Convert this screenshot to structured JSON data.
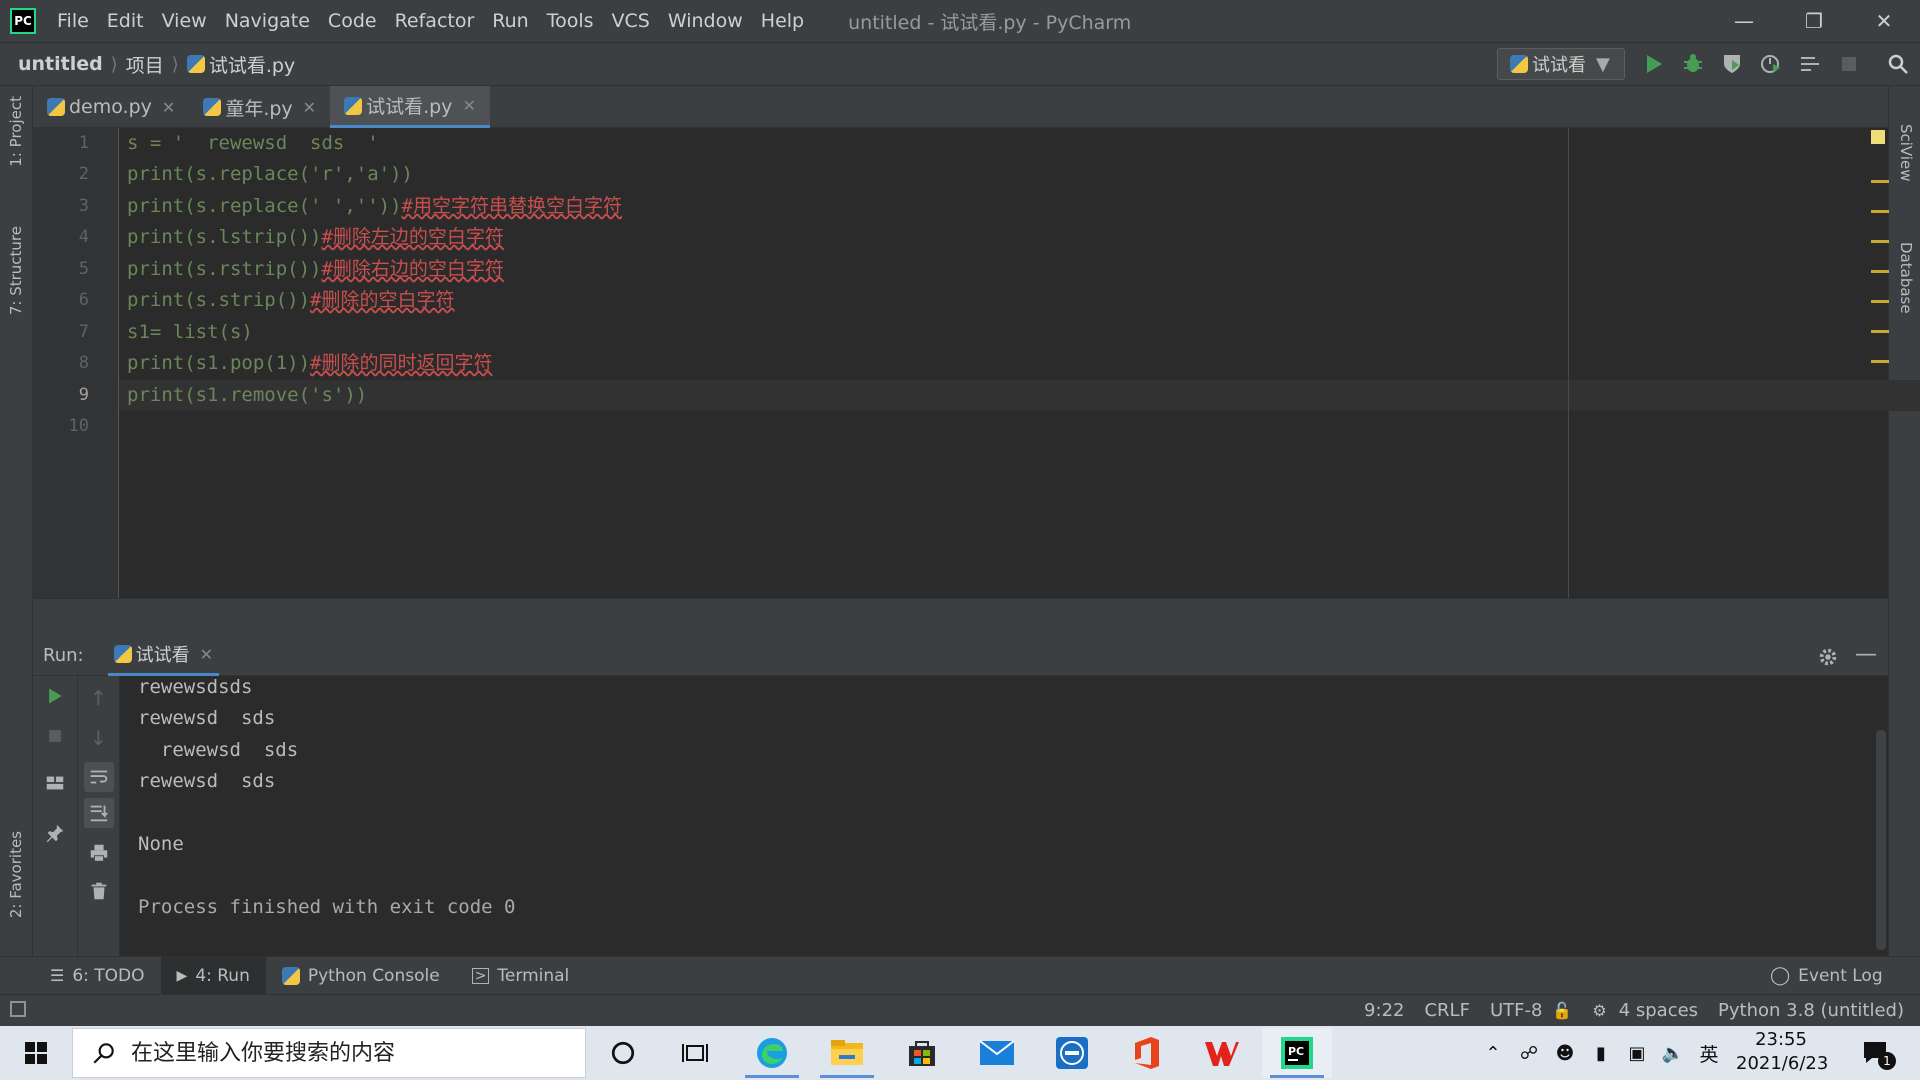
{
  "window": {
    "title": "untitled - 试试看.py - PyCharm",
    "app_logo": "PC",
    "menu": [
      "File",
      "Edit",
      "View",
      "Navigate",
      "Code",
      "Refactor",
      "Run",
      "Tools",
      "VCS",
      "Window",
      "Help"
    ]
  },
  "nav": {
    "breadcrumb": [
      "untitled",
      "项目",
      "试试看.py"
    ],
    "run_config": "试试看"
  },
  "left_stripe": {
    "project": "1: Project",
    "structure": "7: Structure",
    "favorites": "2: Favorites"
  },
  "right_stripe": {
    "sciview": "SciView",
    "database": "Database"
  },
  "tabs": [
    {
      "label": "demo.py",
      "active": false
    },
    {
      "label": "童年.py",
      "active": false
    },
    {
      "label": "试试看.py",
      "active": true
    }
  ],
  "editor": {
    "line_numbers": [
      "1",
      "2",
      "3",
      "4",
      "5",
      "6",
      "7",
      "8",
      "9",
      "10"
    ],
    "current_line": 9,
    "lines": [
      [
        "s = '  rewewsd  sds  '"
      ],
      [
        "print(s.replace('r','a'))"
      ],
      [
        "print(s.replace(' ',''))",
        "#用空字符串替换空白字符"
      ],
      [
        "print(s.lstrip())",
        "#删除左边的空白字符"
      ],
      [
        "print(s.rstrip())",
        "#删除右边的空白字符"
      ],
      [
        "print(s.strip())",
        "#删除的空白字符"
      ],
      [
        "s1= list(s)"
      ],
      [
        "print(s1.pop(1))",
        "#删除的同时返回字符"
      ],
      [
        "print(s1.remove('s'))"
      ],
      [
        ""
      ]
    ]
  },
  "run_panel": {
    "label": "Run:",
    "tab": "试试看",
    "output": [
      "rewewsdsds",
      "rewewsd  sds",
      "  rewewsd  sds",
      "rewewsd  sds",
      "",
      "None",
      "",
      "Process finished with exit code 0"
    ]
  },
  "tool_windows": {
    "todo": "6: TODO",
    "run": "4: Run",
    "python_console": "Python Console",
    "terminal": "Terminal",
    "event_log": "Event Log"
  },
  "status": {
    "position": "9:22",
    "line_sep": "CRLF",
    "encoding": "UTF-8",
    "indent": "4 spaces",
    "interpreter": "Python 3.8 (untitled)"
  },
  "taskbar": {
    "search_placeholder": "在这里输入你要搜索的内容",
    "ime": "英",
    "time": "23:55",
    "date": "2021/6/23",
    "notification_count": "1"
  },
  "colors": {
    "accent": "#4a88c7",
    "run_green": "#499c54",
    "string": "#6a8759",
    "keyword": "#cc7832",
    "comment_error": "#c94e4e"
  }
}
